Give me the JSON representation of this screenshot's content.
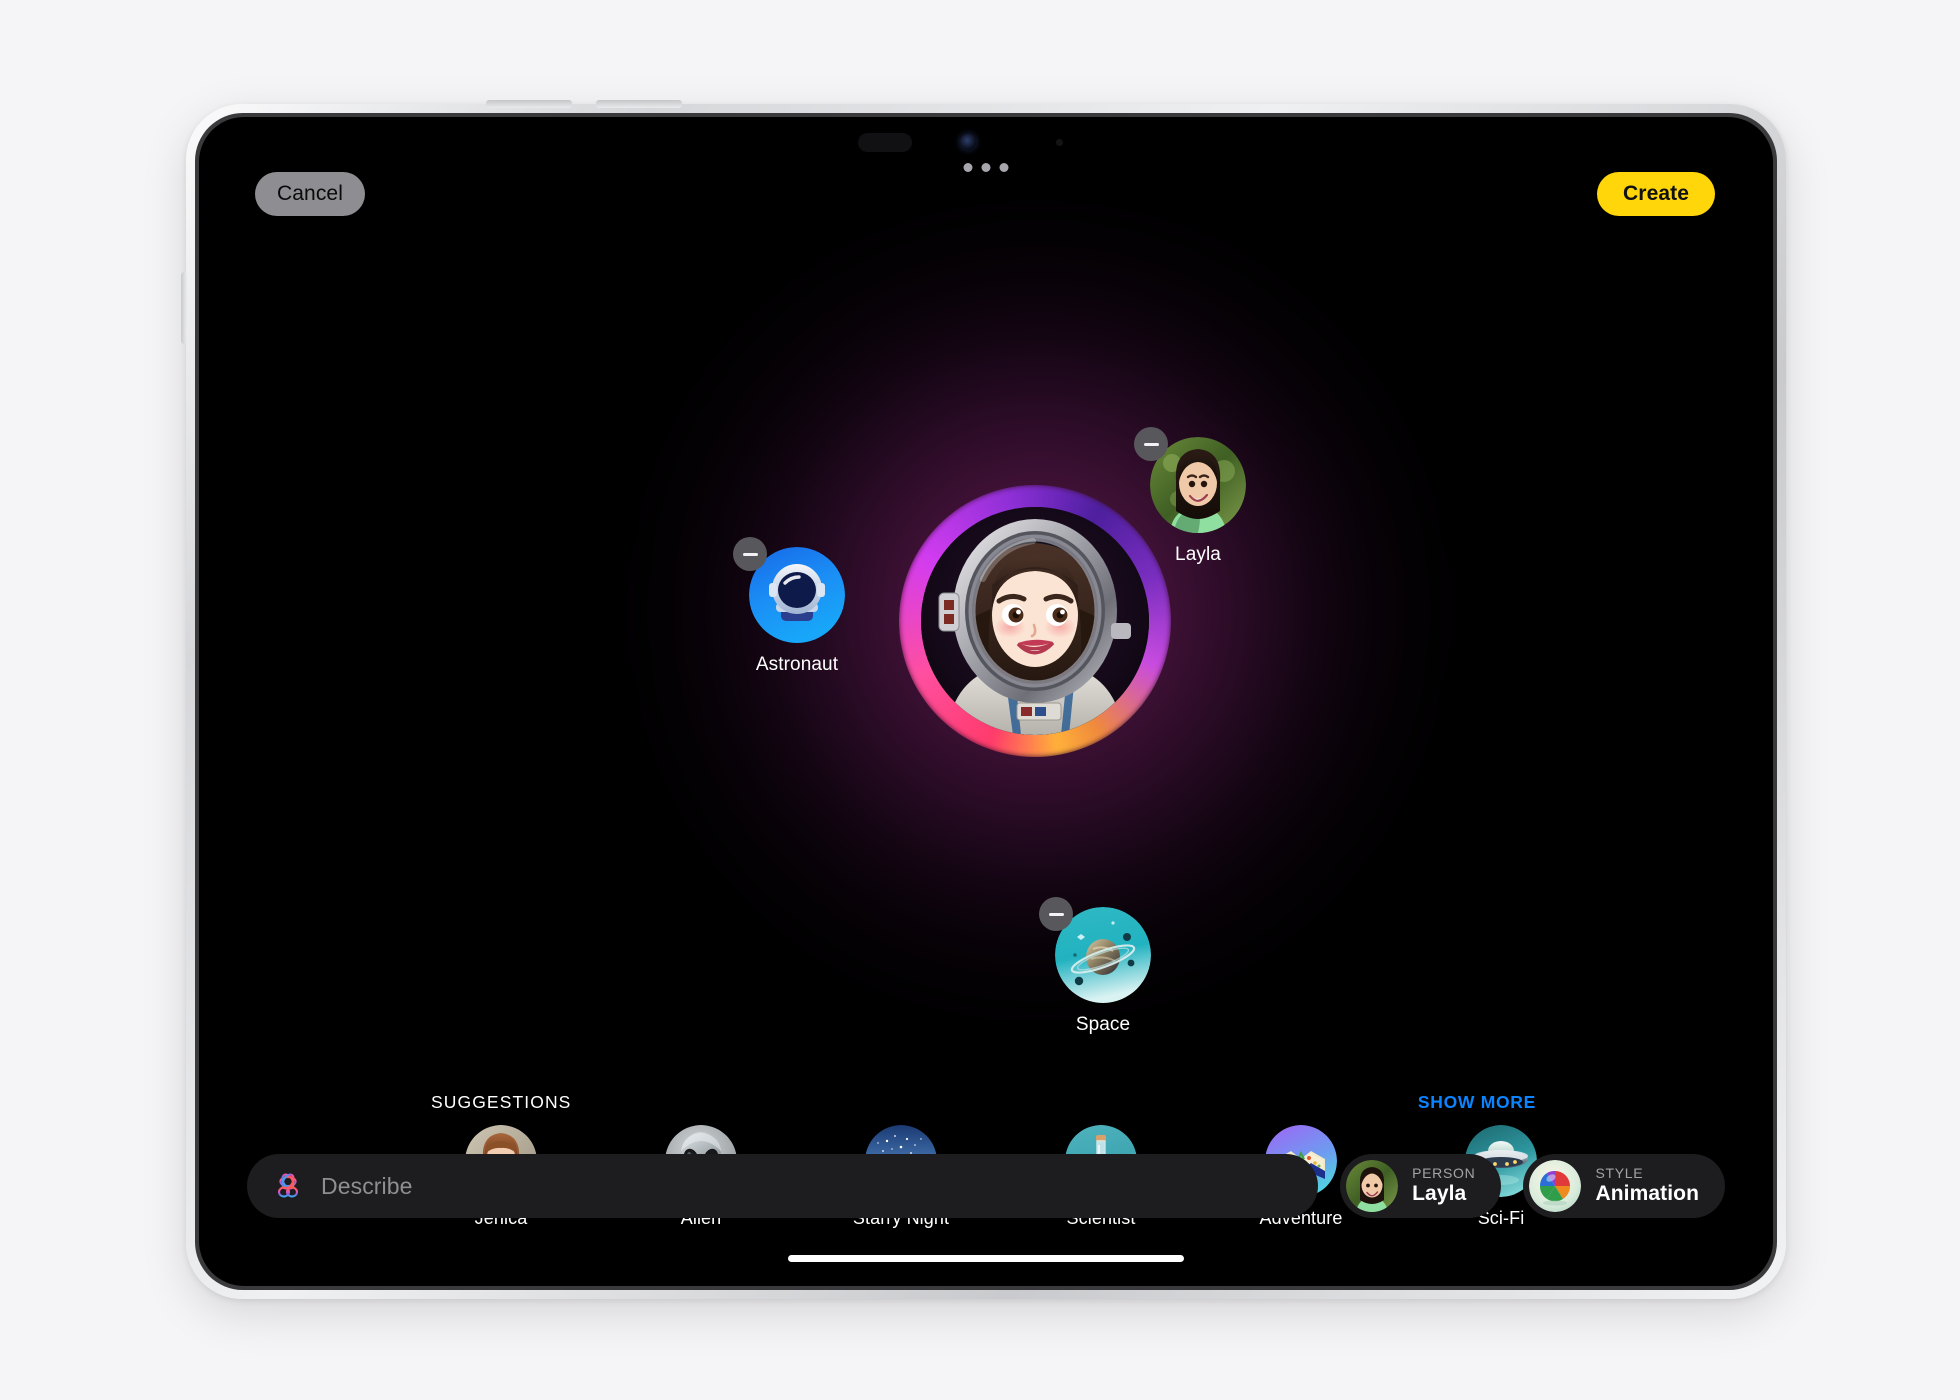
{
  "app": {
    "name": "Image Playground",
    "device": "iPad"
  },
  "toolbar": {
    "cancel_label": "Cancel",
    "create_label": "Create",
    "create_color": "#ffd60a"
  },
  "canvas": {
    "main_image_alt": "Animated astronaut portrait of Layla",
    "concepts": [
      {
        "id": "astronaut",
        "label": "Astronaut",
        "remove_label": "Remove Astronaut",
        "icon": "space-helmet-icon",
        "accent": "#1b8ff5"
      },
      {
        "id": "layla",
        "label": "Layla",
        "remove_label": "Remove Layla",
        "icon": "person-photo-icon",
        "accent": "#5d7a3c"
      },
      {
        "id": "space",
        "label": "Space",
        "remove_label": "Remove Space",
        "icon": "ringed-planet-icon",
        "accent": "#25bfc4"
      }
    ]
  },
  "suggestions": {
    "header": "SUGGESTIONS",
    "show_more_label": "SHOW MORE",
    "show_more_color": "#0a84ff",
    "items": [
      {
        "id": "jenica",
        "label": "Jenica",
        "icon": "person-photo-icon"
      },
      {
        "id": "alien",
        "label": "Alien",
        "icon": "alien-head-icon"
      },
      {
        "id": "starry-night",
        "label": "Starry Night",
        "icon": "starry-sky-icon"
      },
      {
        "id": "scientist",
        "label": "Scientist",
        "icon": "flask-icon"
      },
      {
        "id": "adventure",
        "label": "Adventure",
        "icon": "folded-map-icon"
      },
      {
        "id": "sci-fi",
        "label": "Sci-Fi",
        "icon": "ufo-icon"
      }
    ]
  },
  "composer": {
    "describe_placeholder": "Describe",
    "describe_value": "",
    "describe_icon": "image-playground-icon",
    "person": {
      "key": "PERSON",
      "value": "Layla",
      "icon": "person-photo-icon"
    },
    "style": {
      "key": "STYLE",
      "value": "Animation",
      "icon": "style-sphere-icon"
    }
  },
  "system": {
    "multitask_label": "Multitasking controls",
    "home_indicator_label": "Home indicator"
  }
}
